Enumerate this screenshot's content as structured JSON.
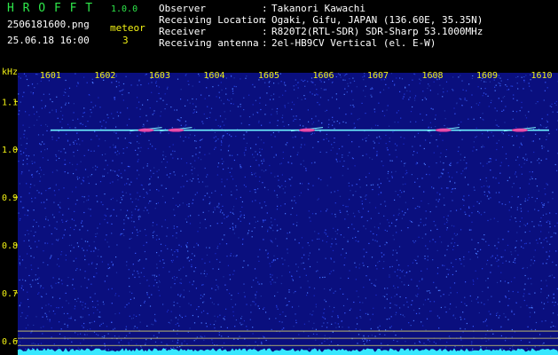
{
  "header": {
    "app_name": "H R O F F T",
    "version": "1.0.0",
    "filename": "2506181600.png",
    "mode": "meteor",
    "timestamp": "25.06.18 16:00",
    "count": "3",
    "fields": [
      {
        "label": "Observer",
        "sep": ":",
        "value": "Takanori Kawachi"
      },
      {
        "label": "Receiving Location",
        "sep": ":",
        "value": "Ogaki, Gifu, JAPAN (136.60E, 35.35N)"
      },
      {
        "label": "Receiver",
        "sep": ":",
        "value": "R820T2(RTL-SDR) SDR-Sharp 53.1000MHz"
      },
      {
        "label": "Receiving antenna",
        "sep": ":",
        "value": "2el-HB9CV Vertical (el. E-W)"
      }
    ]
  },
  "spectrogram": {
    "y_unit": "kHz",
    "x_ticks": [
      "1601",
      "1602",
      "1603",
      "1604",
      "1605",
      "1606",
      "1607",
      "1608",
      "1609",
      "1610"
    ],
    "y_ticks": [
      "1.1",
      "1.0",
      "0.9",
      "0.8",
      "0.7",
      "0.6"
    ],
    "y_tick_values": [
      1.1,
      1.0,
      0.9,
      0.8,
      0.7,
      0.6
    ],
    "y_range": [
      0.57,
      1.16
    ],
    "x_range": [
      1600.4,
      1610.3
    ],
    "carrier_khz": 1.04,
    "carrier_start": 1601.0,
    "meteor_echoes": [
      1602.75,
      1603.3,
      1605.7,
      1608.2,
      1609.6
    ],
    "reference_lines_khz": [
      0.62,
      0.605,
      0.59
    ],
    "colors": {
      "background": "#0a0f7e",
      "tick_labels": "#f2f214",
      "carrier": "#6ff2ff",
      "echo_hot": "#ff3aa0",
      "ref_line": "#d8d26a",
      "noise_floor": "#38e8ff"
    }
  }
}
